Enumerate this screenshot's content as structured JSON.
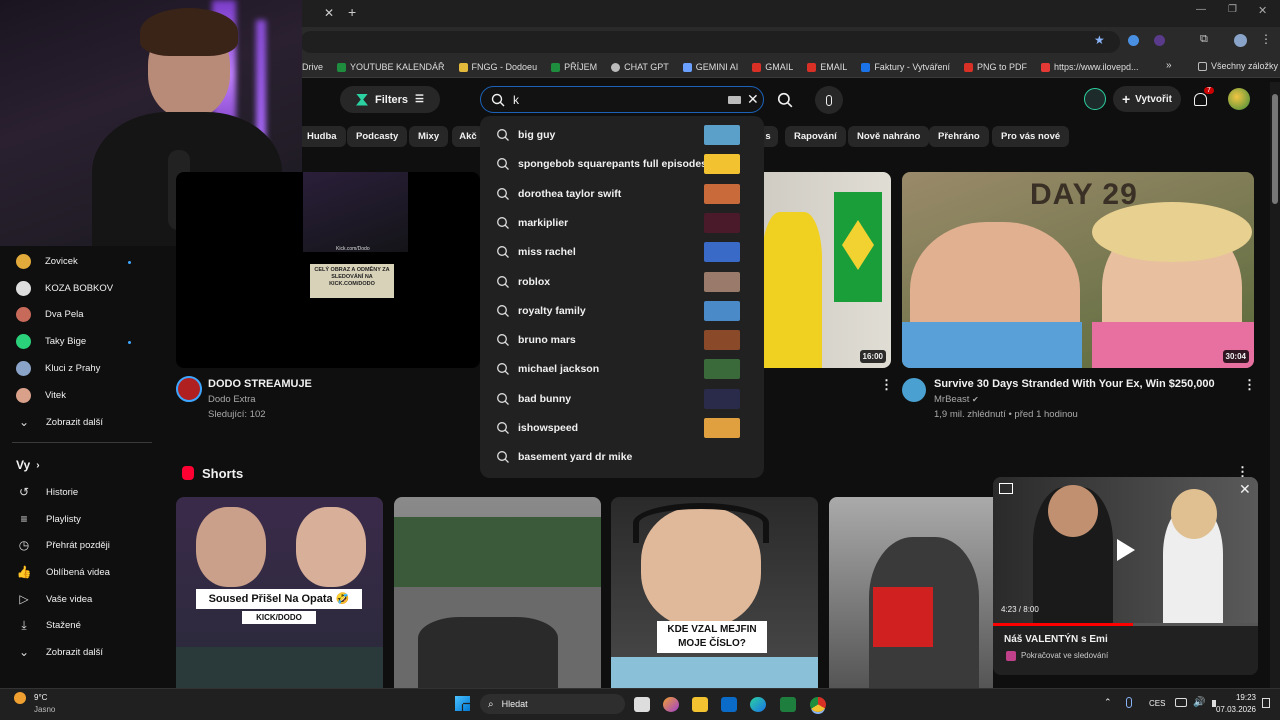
{
  "bookmarks": [
    "Drive",
    "YOUTUBE KALENDÁŘ",
    "FNGG - Dodoeu",
    "PŘÍJEM",
    "CHAT GPT",
    "GEMINI AI",
    "GMAIL",
    "EMAIL",
    "Faktury - Vytváření",
    "PNG to PDF",
    "https://www.ilovepd...",
    "Všechny záložky"
  ],
  "header": {
    "filters": "Filters",
    "search_value": "k",
    "create": "Vytvořit",
    "notif_count": "7"
  },
  "chips": [
    "Hudba",
    "Podcasty",
    "Mixy",
    "Akč",
    "s",
    "Rapování",
    "Nově nahráno",
    "Přehráno",
    "Pro vás nové"
  ],
  "suggestions": [
    "big guy",
    "spongebob squarepants full episodes",
    "dorothea taylor swift",
    "markiplier",
    "miss rachel",
    "roblox",
    "royalty family",
    "bruno mars",
    "michael jackson",
    "bad bunny",
    "ishowspeed",
    "basement yard dr mike"
  ],
  "sidebar": {
    "subs": [
      {
        "name": "Zovicek",
        "dot": true
      },
      {
        "name": "KOZA BOBKOV",
        "dot": false
      },
      {
        "name": "Dva Pela",
        "dot": false
      },
      {
        "name": "Taky Bige",
        "dot": true
      },
      {
        "name": "Kluci z Prahy",
        "dot": false
      },
      {
        "name": "Vitek",
        "dot": false
      }
    ],
    "show_more": "Zobrazit další",
    "you_title": "Vy",
    "you_items": [
      "Historie",
      "Playlisty",
      "Přehrát později",
      "Oblíbená videa",
      "Vaše videa",
      "Stažené",
      "Zobrazit další"
    ]
  },
  "videos": {
    "live": {
      "title": "DODO STREAMUJE",
      "channel": "Dodo Extra",
      "meta": "Sledující: 102",
      "overlay1": "Kick.com/Dodo",
      "overlay2": "CELÝ OBRAZ A ODMĚNY ZA SLEDOVÁNÍ NA KICK.COM/DODO"
    },
    "mid": {
      "duration": "16:00"
    },
    "mrbeast": {
      "title": "Survive 30 Days Stranded With Your Ex, Win $250,000",
      "channel": "MrBeast",
      "meta": "1,9 mil. zhlédnutí • před 1 hodinou",
      "duration": "30:04",
      "thumb_text": "DAY 29"
    }
  },
  "shorts": {
    "title": "Shorts",
    "s1_caption": "Soused Přišel Na Opata 🤣",
    "s1_sub": "KICK/DODO",
    "s3_caption": "KDE VZAL MEJFIN MOJE ČÍSLO?"
  },
  "miniplayer": {
    "title": "Náš VALENTÝN s Emi",
    "time": "4:23 / 8:00",
    "continue": "Pokračovat ve sledování",
    "progress": 0.53
  },
  "taskbar": {
    "temp": "9°C",
    "weather": "Jasno",
    "search": "Hledat",
    "lang": "CES",
    "time": "19:23",
    "date": "07.03.2026"
  },
  "colors": {
    "bg": "#0f0f0f",
    "chip": "#272727",
    "accent": "#ff0000",
    "link": "#3ea6ff"
  }
}
